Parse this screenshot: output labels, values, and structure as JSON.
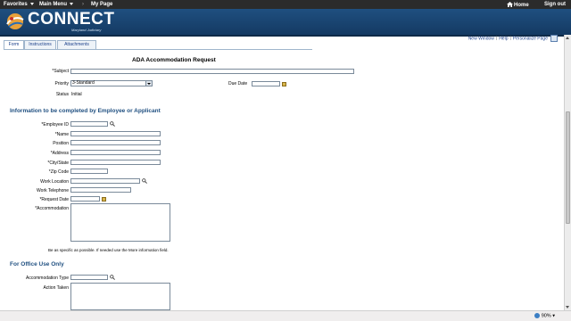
{
  "topnav": {
    "favorites": "Favorites",
    "main_menu": "Main Menu",
    "separator": "›",
    "my_page": "My Page",
    "home": "Home",
    "sign_out": "Sign out"
  },
  "brand": {
    "name": "CONNECT",
    "tagline": "Maryland Judiciary"
  },
  "pagelinks": {
    "new_window": "New Window",
    "help": "Help",
    "personalize": "Personalize Page"
  },
  "tabs": [
    "Form",
    "Instructions",
    "Attachments"
  ],
  "form": {
    "title": "ADA Accommodation Request",
    "subject_label": "*Subject",
    "subject_value": "",
    "priority_label": "Priority",
    "priority_value": "3-Standard",
    "due_date_label": "Due Date",
    "due_date_value": "",
    "status_label": "Status",
    "status_value": "Initial"
  },
  "employee_section": {
    "heading": "Information to be completed by Employee or Applicant",
    "fields": {
      "employee_id": "*Employee ID",
      "name": "*Name",
      "position": "Position",
      "address": "*Address",
      "city_state": "*City/State",
      "zip": "*Zip Code",
      "work_location": "Work Location",
      "work_telephone": "Work Telephone",
      "request_date": "*Request Date",
      "accommodation": "*Accommodation"
    },
    "hint": "Be as specific as possible. If needed use the More information field."
  },
  "office_section": {
    "heading": "For Office Use Only",
    "accommodation_type": "Accommodation Type",
    "action_taken": "Action Taken"
  },
  "statusbar": {
    "zoom": "90%"
  }
}
